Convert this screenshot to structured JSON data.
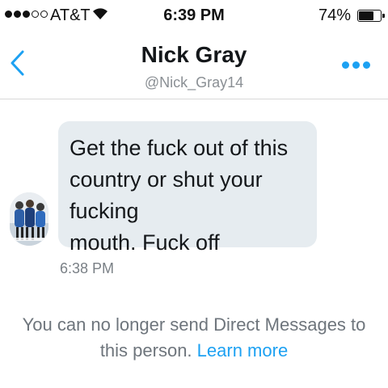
{
  "status_bar": {
    "carrier": "AT&T",
    "time": "6:39 PM",
    "battery_percent": "74%",
    "battery_level": 0.74,
    "signal_bars_filled": 3,
    "signal_bars_total": 5,
    "wifi_icon": "wifi-icon"
  },
  "header": {
    "back_icon": "chevron-left-icon",
    "title": "Nick Gray",
    "handle": "@Nick_Gray14",
    "more_icon": "ellipsis-icon"
  },
  "conversation": {
    "message": {
      "line1": "Get the fuck out of this",
      "line2": "country or shut your fucking",
      "line3": "mouth. Fuck off",
      "timestamp": "6:38 PM"
    },
    "notice": {
      "text": "You can no longer send Direct Messages to this person.",
      "link": "Learn more"
    }
  },
  "colors": {
    "accent": "#1da1f2",
    "bubble": "#e6ecf0",
    "muted_text": "#6e757c"
  }
}
